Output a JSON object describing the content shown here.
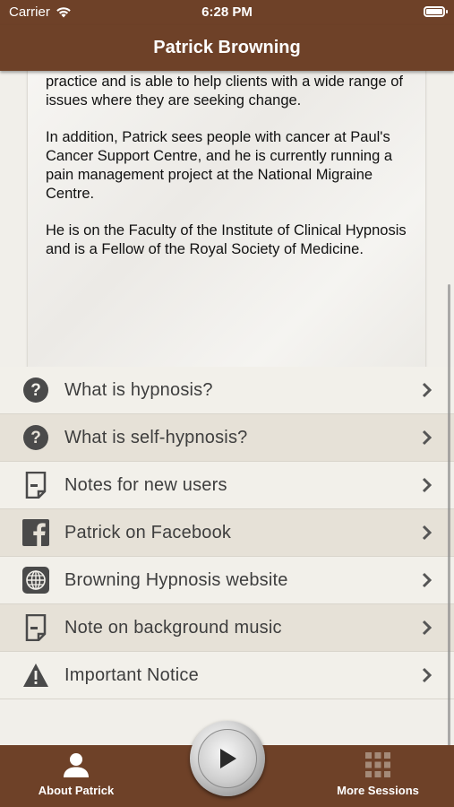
{
  "status_bar": {
    "carrier": "Carrier",
    "time": "6:28 PM"
  },
  "nav": {
    "title": "Patrick Browning"
  },
  "bio": {
    "paragraphs": [
      "practising in Kensington in London. He has a general practice and is able to help clients with a wide range of issues where they are seeking change.",
      "In addition, Patrick sees people with cancer at Paul's Cancer Support Centre, and he is currently running a pain management project at the National Migraine Centre.",
      "He is on the Faculty of the Institute of Clinical Hypnosis and is a Fellow of the Royal Society of Medicine."
    ]
  },
  "menu": {
    "items": [
      {
        "label": "What is hypnosis?",
        "icon": "question-icon"
      },
      {
        "label": "What is self-hypnosis?",
        "icon": "question-icon"
      },
      {
        "label": "Notes for new users",
        "icon": "note-icon"
      },
      {
        "label": "Patrick on Facebook",
        "icon": "facebook-icon"
      },
      {
        "label": "Browning Hypnosis website",
        "icon": "globe-icon"
      },
      {
        "label": "Note on background music",
        "icon": "note-icon"
      },
      {
        "label": "Important Notice",
        "icon": "warning-icon"
      }
    ]
  },
  "tabbar": {
    "left_label": "About Patrick",
    "right_label": "More Sessions",
    "play_icon": "play-icon"
  },
  "colors": {
    "brand_brown": "#6e4128",
    "row_light": "#f2f0ea",
    "row_dark": "#e6e1d7",
    "icon_gray": "#4a4a4a"
  }
}
